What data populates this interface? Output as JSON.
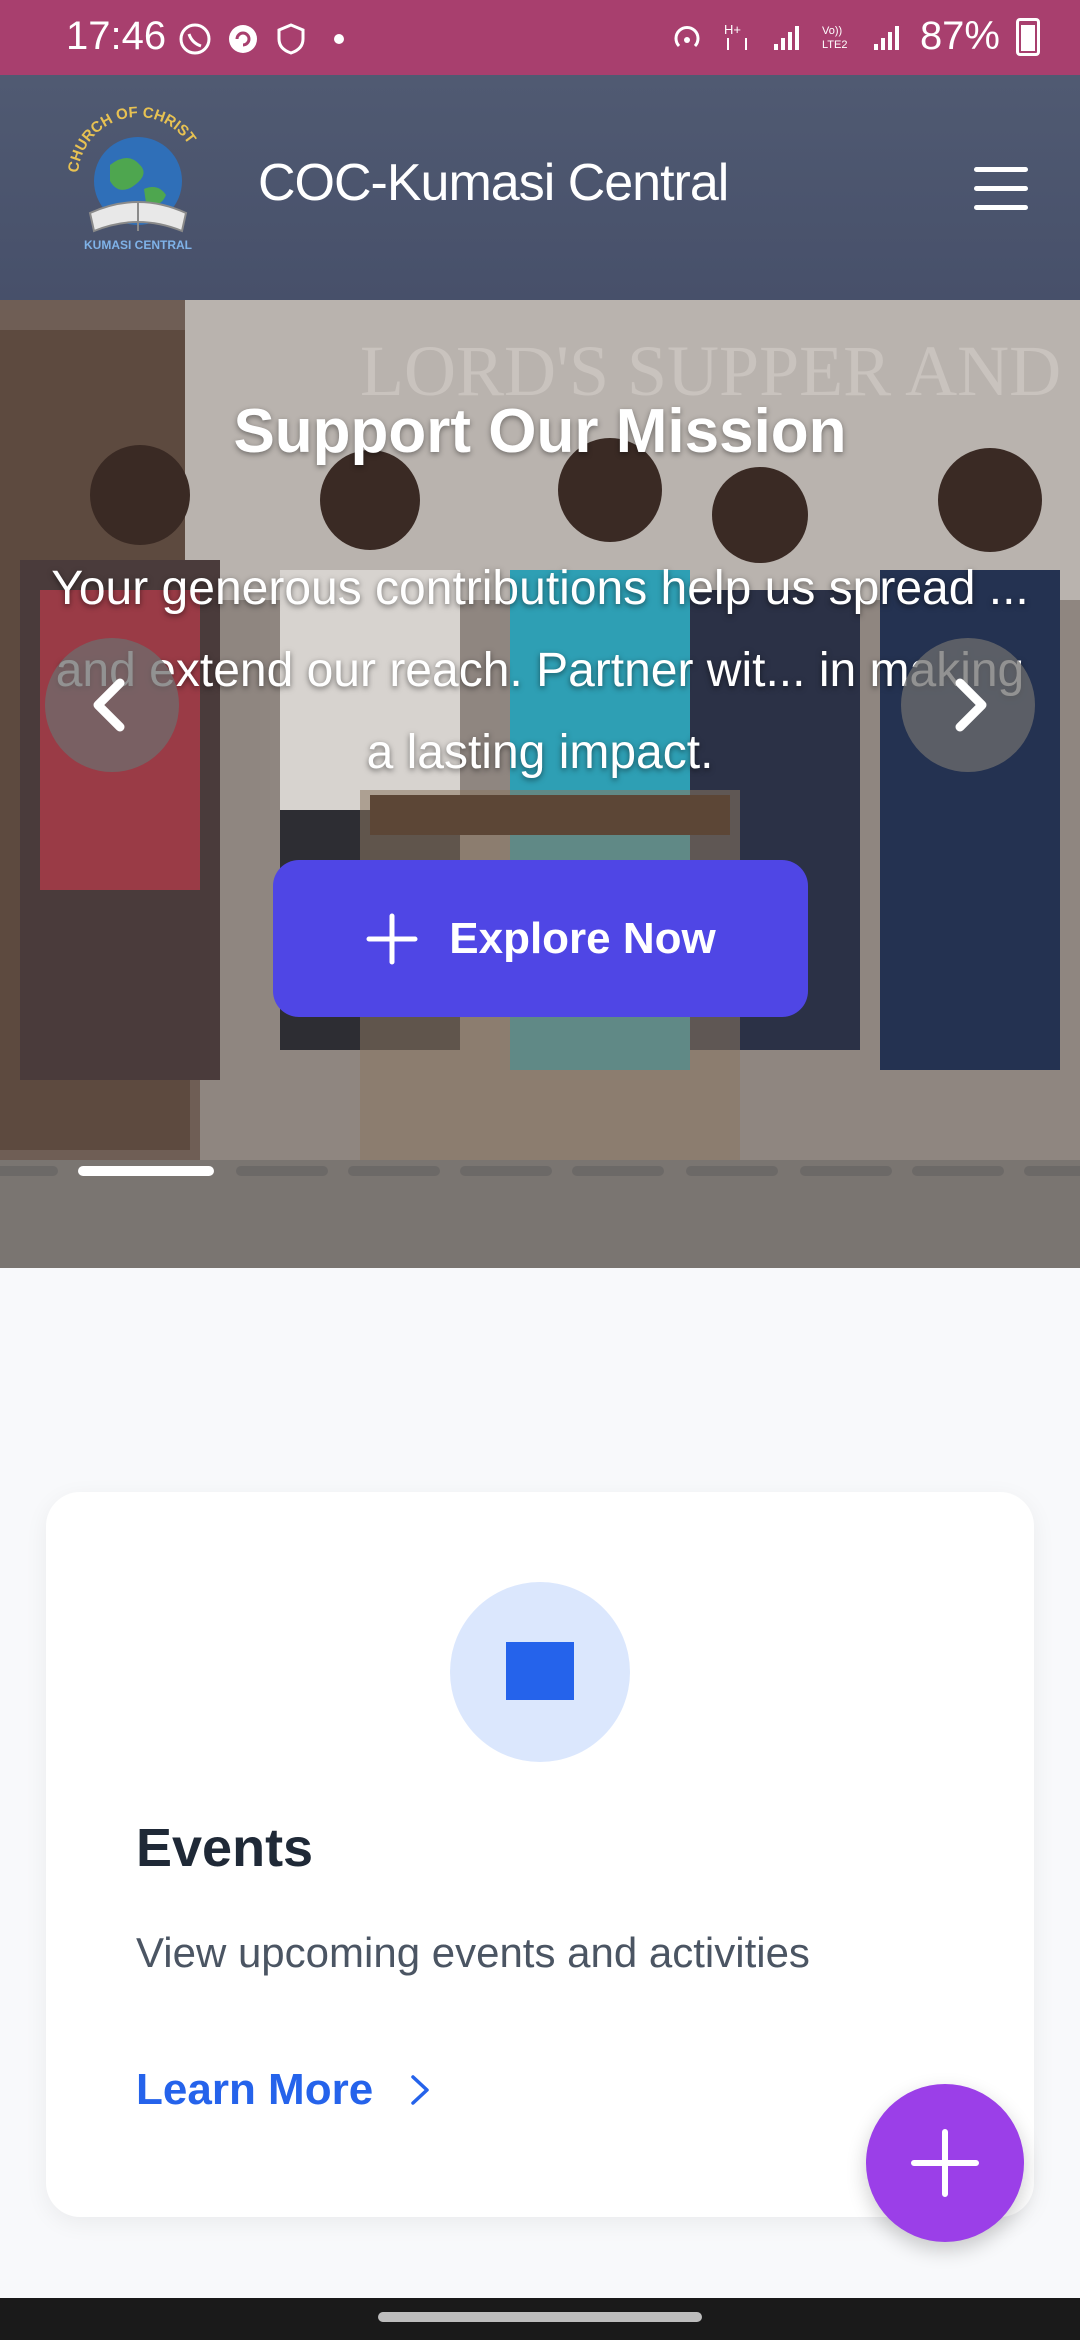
{
  "status_bar": {
    "time": "17:46",
    "battery": "87%",
    "icons": [
      "whatsapp-icon",
      "sync-icon",
      "shield-icon",
      "dot-icon",
      "hotspot-icon",
      "data-icon",
      "signal-icon",
      "volte-icon",
      "signal-icon",
      "battery-icon"
    ]
  },
  "header": {
    "brand": "COC-Kumasi Central",
    "logo_text_top": "CHURCH OF CHRIST",
    "logo_text_bottom": "KUMASI CENTRAL",
    "menu_icon": "hamburger-icon"
  },
  "hero": {
    "title": "Support Our Mission",
    "text": "Your generous contributions help us spread ... and extend our reach. Partner wit... in making a lasting impact.",
    "button_label": "Explore Now",
    "button_icon": "plus-icon",
    "slides_total": 10,
    "active_slide": 1,
    "background_text": "LORD'S SUPPER AND GIV"
  },
  "card": {
    "title": "Events",
    "description": "View upcoming events and activities",
    "link_label": "Learn More",
    "icon": "square-icon"
  },
  "fab": {
    "icon": "plus-icon"
  },
  "colors": {
    "status_bar": "#a83f6e",
    "header": "#4b5470",
    "primary_button": "#4f46e5",
    "link": "#2563eb",
    "fab": "#9b3fe8"
  }
}
